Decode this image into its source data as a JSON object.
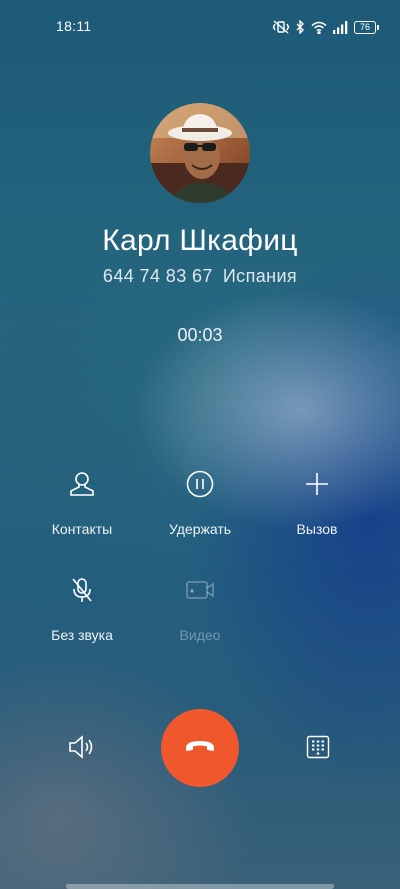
{
  "status_bar": {
    "time": "18:11",
    "battery": "76",
    "icons": [
      "vibrate-off-icon",
      "bluetooth-icon",
      "wifi-icon",
      "signal-icon",
      "battery-icon"
    ]
  },
  "caller": {
    "name": "Карл Шкафиц",
    "number": "644 74 83 67",
    "location": "Испания",
    "avatar": "avatar-photo"
  },
  "call": {
    "duration": "00:03"
  },
  "actions": [
    {
      "label": "Контакты",
      "icon": "contact-icon",
      "enabled": true
    },
    {
      "label": "Удержать",
      "icon": "pause-icon",
      "enabled": true
    },
    {
      "label": "Вызов",
      "icon": "plus-icon",
      "enabled": true
    },
    {
      "label": "Без звука",
      "icon": "mic-off-icon",
      "enabled": true
    },
    {
      "label": "Видео",
      "icon": "video-icon",
      "enabled": false
    }
  ],
  "controls": {
    "speaker": "speaker-icon",
    "end_call": "end-call-icon",
    "keypad": "keypad-icon"
  },
  "colors": {
    "end_call": "#f0572d",
    "text": "#ffffff"
  }
}
